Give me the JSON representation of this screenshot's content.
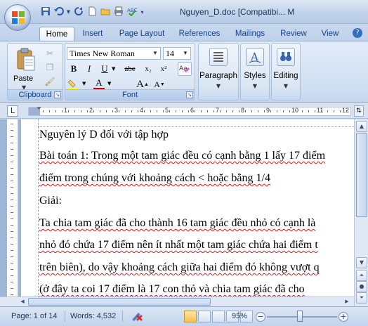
{
  "window": {
    "title": "Nguyen_D.doc [Compatibi... M"
  },
  "quick_access": {
    "icons": [
      "save-icon",
      "undo-icon",
      "redo-icon",
      "new-icon",
      "open-icon",
      "print-icon",
      "spell-icon",
      "dropdown-icon"
    ]
  },
  "tabs": [
    {
      "label": "Home",
      "active": true
    },
    {
      "label": "Insert"
    },
    {
      "label": "Page Layout"
    },
    {
      "label": "References"
    },
    {
      "label": "Mailings"
    },
    {
      "label": "Review"
    },
    {
      "label": "View"
    }
  ],
  "clipboard": {
    "paste_label": "Paste",
    "group_label": "Clipboard"
  },
  "font": {
    "name": "Times New Roman",
    "size": "14",
    "group_label": "Font",
    "bold": "B",
    "italic": "I",
    "underline": "U",
    "strike": "abe",
    "subscript": "x₂",
    "superscript": "x²",
    "grow": "A",
    "shrink": "A",
    "highlight_color": "#ffff00",
    "font_color": "#e00000"
  },
  "groups": {
    "paragraph": "Paragraph",
    "styles": "Styles",
    "editing": "Editing"
  },
  "ruler": {
    "numbers": [
      "1",
      "2",
      "3",
      "4",
      "5",
      "6",
      "7",
      "8",
      "9",
      "10",
      "11",
      "12"
    ]
  },
  "document": {
    "lines": [
      "Nguyên lý D đối với tập hợp",
      "Bài toán 1: Trong một tam giác đều có cạnh bằng 1 lấy 17 điểm",
      "điểm trong chúng với khoảng cách < hoặc bằng 1/4",
      "Giải:",
      "Ta chia  tam giác đã cho thành 16 tam giác đều nhỏ có cạnh là",
      "nhỏ đó chứa 17 điểm nên ít nhất một tam giác chứa hai điểm t",
      "trên biên), do vậy khoảng cách giữa hai điểm đó không vượt q",
      "(ở đây ta coi 17 điểm là 17 con thỏ và chia tam giác đã cho"
    ]
  },
  "status": {
    "page": "Page: 1 of 14",
    "words": "Words: 4,532",
    "zoom": "95%",
    "zoom_level_percent": 95
  }
}
